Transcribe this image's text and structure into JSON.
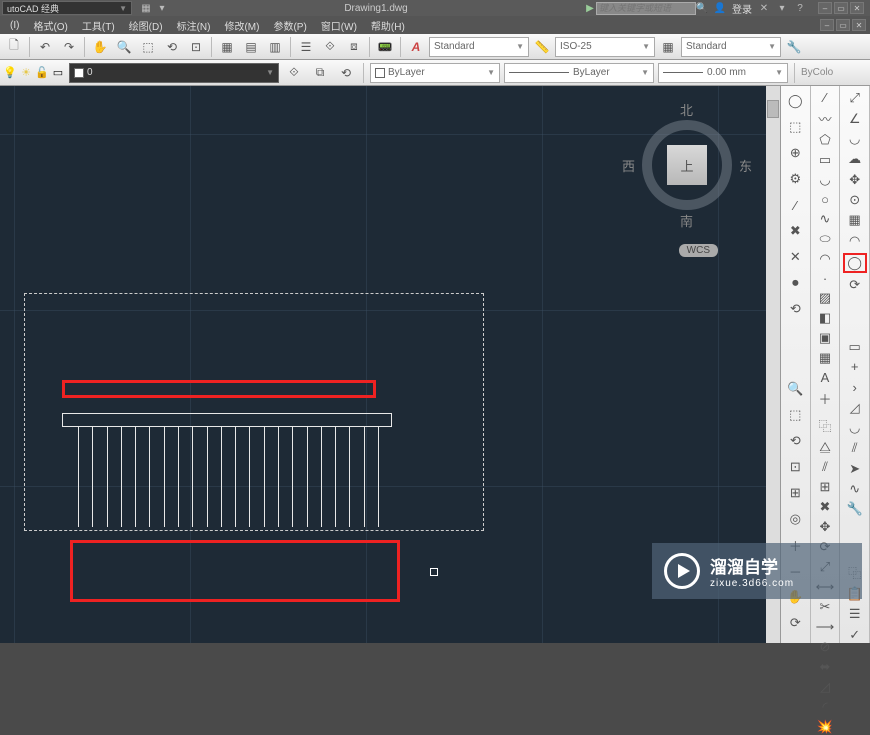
{
  "title": {
    "workspace": "utoCAD 经典",
    "document": "Drawing1.dwg",
    "search_placeholder": "键入关键字或短语",
    "login": "登录"
  },
  "menus": [
    "(I)",
    "格式(O)",
    "工具(T)",
    "绘图(D)",
    "标注(N)",
    "修改(M)",
    "参数(P)",
    "窗口(W)",
    "帮助(H)"
  ],
  "style_bar": {
    "text_style": "Standard",
    "dim_style": "ISO-25",
    "table_style": "Standard"
  },
  "prop_bar": {
    "layer_value": "0",
    "color": "ByLayer",
    "linetype": "ByLayer",
    "lineweight": "0.00 mm",
    "plotstyle": "ByColo"
  },
  "viewcube": {
    "top": "上",
    "n": "北",
    "s": "南",
    "e": "东",
    "w": "西",
    "wcs": "WCS"
  },
  "watermark": {
    "brand": "溜溜自学",
    "url": "zixue.3d66.com"
  },
  "toolbar1_icons": [
    ":new",
    ":open",
    ":save",
    ":|",
    ":undo",
    ":redo",
    ":|",
    ":pan",
    ":zoom-rt",
    ":zoom-win",
    ":zoom-prev",
    ":|",
    ":props",
    ":sheet",
    ":tool-pal",
    ":|",
    ":layer-mgr",
    ":layer-prev",
    ":layer-iso",
    ":|",
    ":calc"
  ],
  "right_col1": [
    "sphere",
    "cylinder",
    "globe",
    "settings",
    "line",
    "delete",
    "x",
    "record",
    "rewind",
    "gap",
    "zoom-rt",
    "zoom-win",
    "zoom-prev",
    "zoom-all",
    "zoom-dyn",
    "zoom-obj",
    "zoom-in",
    "zoom-out",
    "pan",
    "orbit"
  ],
  "right_col2": [
    "line",
    "pline",
    "polygon",
    "rect",
    "arc",
    "circle",
    "spline",
    "ellipse",
    "earc",
    "point",
    "hatch",
    "grad",
    "region",
    "table",
    "mtext",
    "add",
    "gap",
    "copy",
    "mirror",
    "offset",
    "array",
    "delete2",
    "move",
    "rotate",
    "scale",
    "stretch",
    "trim",
    "extend",
    "break",
    "join",
    "chamfer",
    "fillet",
    "explode"
  ],
  "right_col3": [
    "scale-tool",
    "angle",
    "curve",
    "cloud",
    "move2",
    "snap",
    "grid",
    "radius",
    "tangent",
    "rotate2",
    "gap",
    "rectangle",
    "plus",
    "chevron",
    "corner",
    "arc2",
    "double",
    "arrow",
    "curve2",
    "tool",
    "gap",
    "copy-p",
    "paste-p",
    "layer-p",
    "match-p"
  ]
}
